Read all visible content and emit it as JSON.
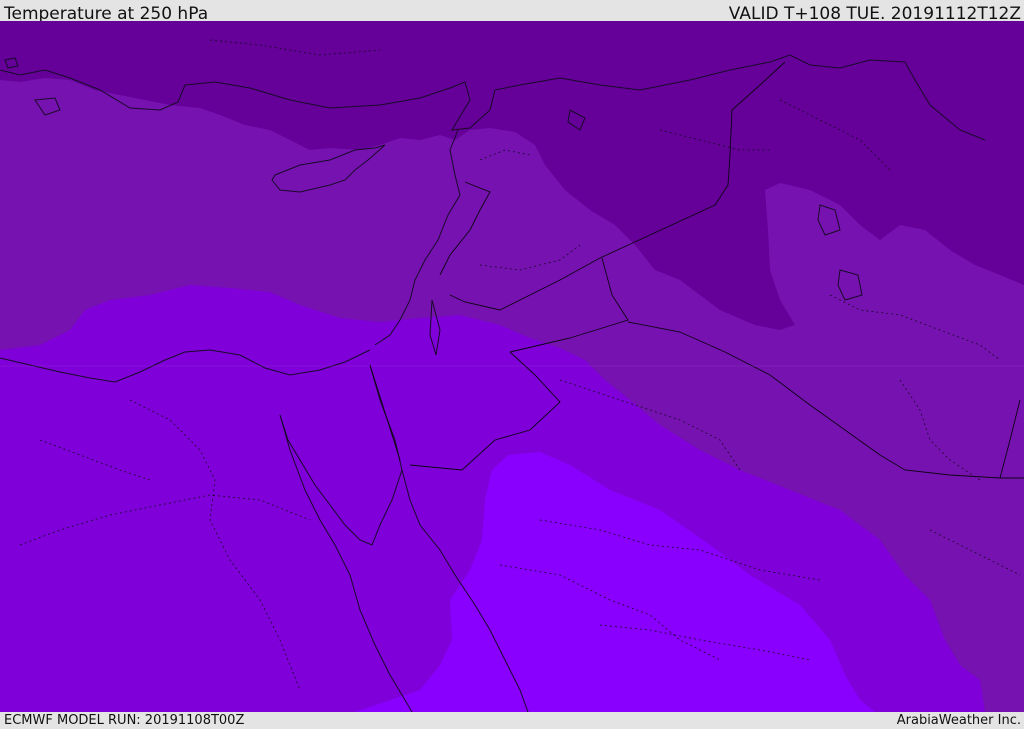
{
  "header": {
    "title": "Temperature at 250 hPa",
    "valid_time": "VALID T+108 TUE. 20191112T12Z"
  },
  "footer": {
    "model_run": "ECMWF MODEL RUN: 20191108T00Z",
    "credit": "ArabiaWeather Inc."
  },
  "map": {
    "field": "temperature",
    "level": "250 hPa",
    "region": "Eastern Mediterranean / Middle East",
    "colors": {
      "band_coldest": "#650099",
      "band_cold": "#7612b0",
      "band_mid": "#7f00d9",
      "band_warm": "#8a00ff",
      "coastline": "#1a0a2a",
      "border": "#0d0414"
    }
  }
}
